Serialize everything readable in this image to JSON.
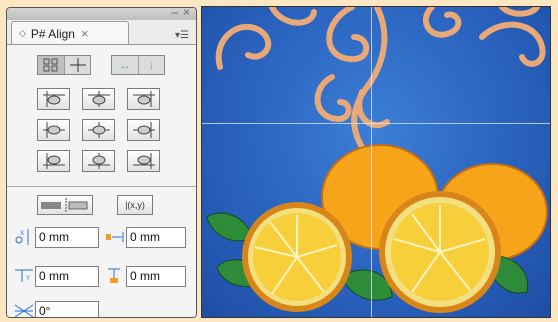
{
  "panel": {
    "tab_title": "P# Align",
    "fields": {
      "x_offset": "0 mm",
      "x_spacing": "0 mm",
      "y_offset": "0 mm",
      "y_spacing": "0 mm",
      "rotation": "0°"
    }
  }
}
